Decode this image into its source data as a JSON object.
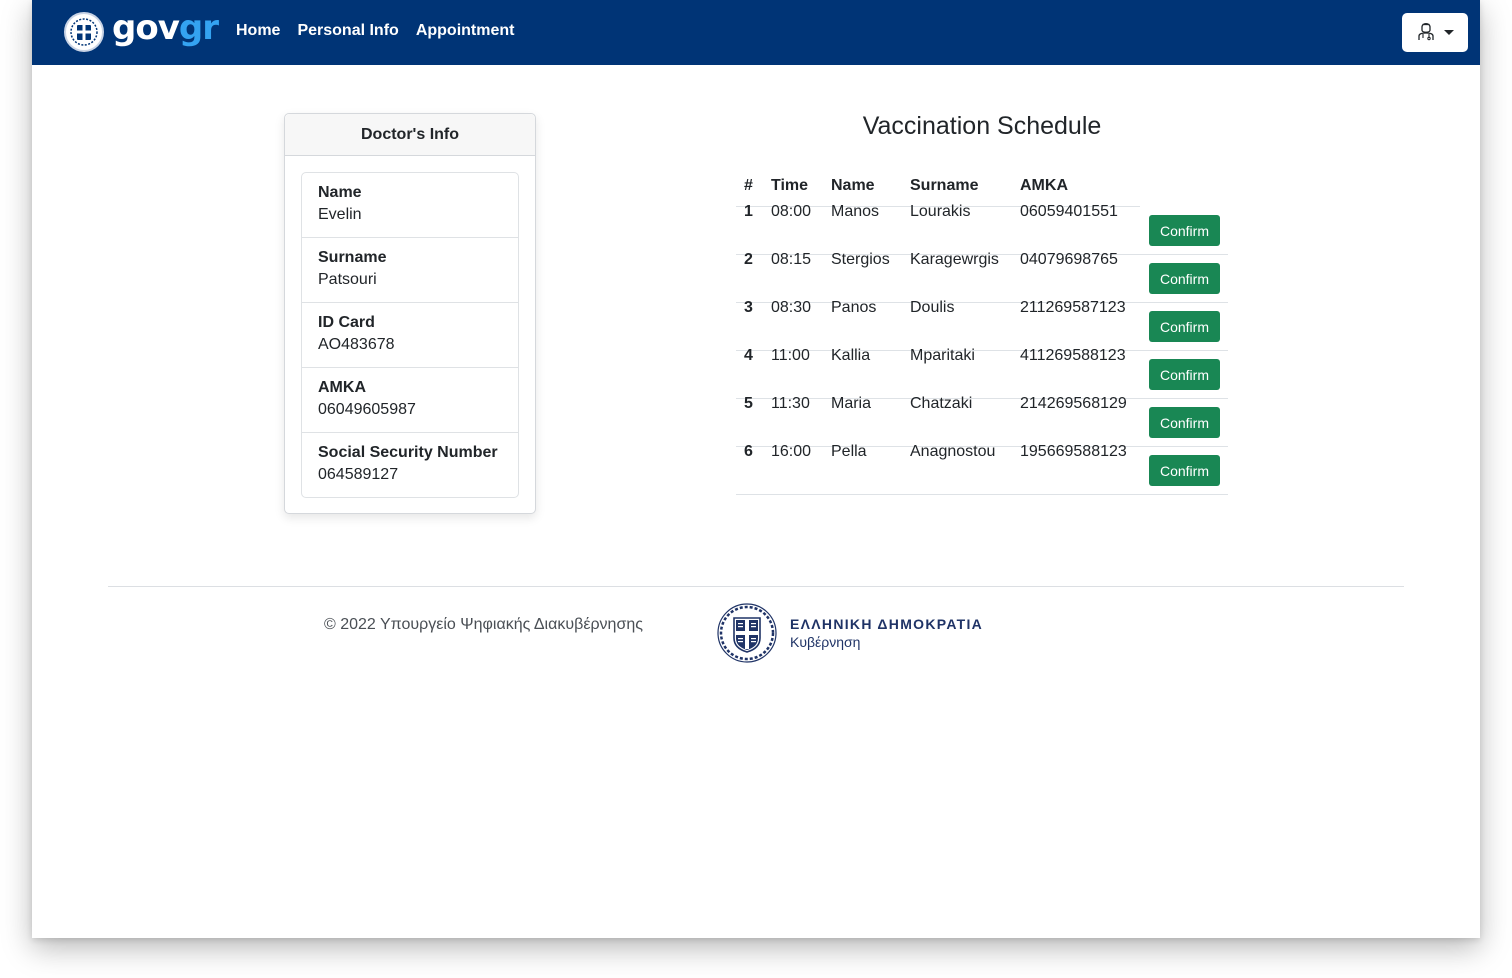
{
  "navbar": {
    "brand_gov": "gov",
    "brand_gr": "gr",
    "links": [
      {
        "label": "Home"
      },
      {
        "label": "Personal Info"
      },
      {
        "label": "Appointment"
      }
    ],
    "user_menu_icon": "doctor-avatar-icon",
    "colors": {
      "background": "#003476",
      "brand_accent": "#34a3f1"
    }
  },
  "doctor_card": {
    "title": "Doctor's Info",
    "fields": [
      {
        "label": "Name",
        "value": "Evelin"
      },
      {
        "label": "Surname",
        "value": "Patsouri"
      },
      {
        "label": "ID Card",
        "value": "AO483678"
      },
      {
        "label": "AMKA",
        "value": "06049605987"
      },
      {
        "label": "Social Security Number",
        "value": "064589127"
      }
    ]
  },
  "schedule": {
    "title": "Vaccination Schedule",
    "columns": [
      "#",
      "Time",
      "Name",
      "Surname",
      "AMKA"
    ],
    "confirm_label": "Confirm",
    "confirm_color": "#198754",
    "rows": [
      {
        "num": "1",
        "time": "08:00",
        "name": "Manos",
        "surname": "Lourakis",
        "amka": "06059401551"
      },
      {
        "num": "2",
        "time": "08:15",
        "name": "Stergios",
        "surname": "Karagewrgis",
        "amka": "04079698765"
      },
      {
        "num": "3",
        "time": "08:30",
        "name": "Panos",
        "surname": "Doulis",
        "amka": "211269587123"
      },
      {
        "num": "4",
        "time": "11:00",
        "name": "Kallia",
        "surname": "Mparitaki",
        "amka": "411269588123"
      },
      {
        "num": "5",
        "time": "11:30",
        "name": "Maria",
        "surname": "Chatzaki",
        "amka": "214269568129"
      },
      {
        "num": "6",
        "time": "16:00",
        "name": "Pella",
        "surname": "Anagnostou",
        "amka": "195669588123"
      }
    ]
  },
  "footer": {
    "copyright": "© 2022 Υπουργείο Ψηφιακής Διακυβέρνησης",
    "gov_line1": "ΕΛΛΗΝΙΚΗ ΔΗΜΟΚΡΑΤΙΑ",
    "gov_line2": "Κυβέρνηση"
  }
}
